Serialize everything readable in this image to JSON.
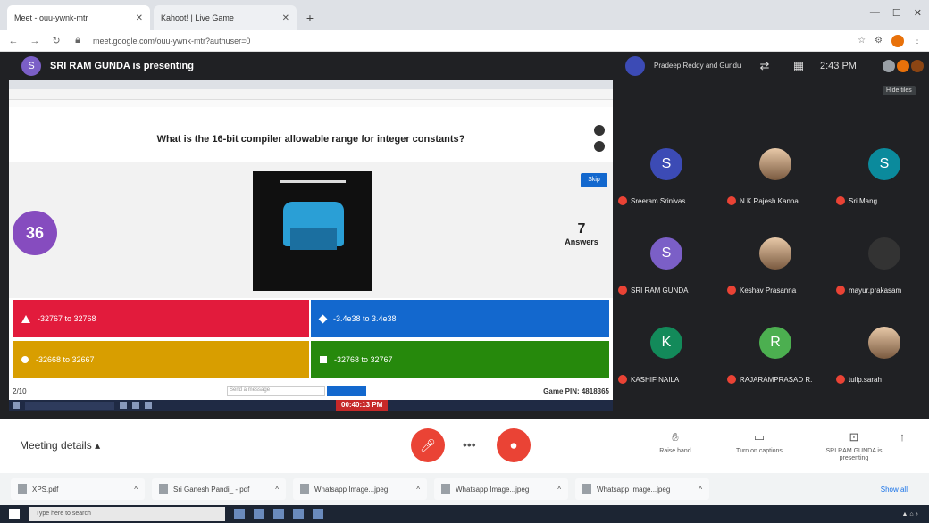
{
  "browser": {
    "tabs": [
      {
        "title": "Meet - ouu-ywnk-mtr"
      },
      {
        "title": "Kahoot! | Live Game"
      }
    ],
    "new_tab": "+",
    "url": "meet.google.com/ouu-ywnk-mtr?authuser=0"
  },
  "meet": {
    "presenter_initial": "S",
    "presenting_text": "SRI RAM GUNDA is presenting",
    "speaker_name": "Pradeep Reddy and Gundu",
    "clock": "2:43 PM",
    "hide_button": "Hide tiles",
    "participants": [
      {
        "initial": "S",
        "name": "Sreeram Srinivas",
        "color": "#3c4bb5"
      },
      {
        "initial": "",
        "name": "N.K.Rajesh Kanna",
        "color": "photo"
      },
      {
        "initial": "S",
        "name": "Sri Mang",
        "color": "#0b8a9c"
      },
      {
        "initial": "S",
        "name": "SRI RAM GUNDA",
        "color": "#7b5fc7"
      },
      {
        "initial": "",
        "name": "Keshav Prasanna",
        "color": "photo"
      },
      {
        "initial": "",
        "name": "mayur.prakasam",
        "color": "#333"
      },
      {
        "initial": "K",
        "name": "KASHIF NAILA",
        "color": "#138a5a"
      },
      {
        "initial": "R",
        "name": "RAJARAMPRASAD R.",
        "color": "#4caf50"
      },
      {
        "initial": "",
        "name": "tulip.sarah",
        "color": "photo"
      }
    ]
  },
  "kahoot": {
    "question": "What is the 16-bit compiler allowable range for integer constants?",
    "timer": "36",
    "skip": "Skip",
    "answers_count": "7",
    "answers_label": "Answers",
    "answers": [
      {
        "text": "-32767 to 32768"
      },
      {
        "text": "-3.4e38 to 3.4e38"
      },
      {
        "text": "-32668 to 32667"
      },
      {
        "text": "-32768 to 32767"
      }
    ],
    "page": "2/10",
    "message_placeholder": "Send a message",
    "pin": "Game PIN: 4818365",
    "recording": "00:40:13 PM"
  },
  "controls": {
    "meeting_details": "Meeting details",
    "raise_hand": "Raise hand",
    "captions": "Turn on captions",
    "stop_presenting": "SRI RAM GUNDA is presenting"
  },
  "downloads": [
    {
      "name": "XPS.pdf"
    },
    {
      "name": "Sri Ganesh Pandi_ - pdf"
    },
    {
      "name": "Whatsapp Image...jpeg"
    },
    {
      "name": "Whatsapp Image...jpeg"
    },
    {
      "name": "Whatsapp Image...jpeg"
    }
  ],
  "show_all": "Show all",
  "os": {
    "search_placeholder": "Type here to search"
  }
}
